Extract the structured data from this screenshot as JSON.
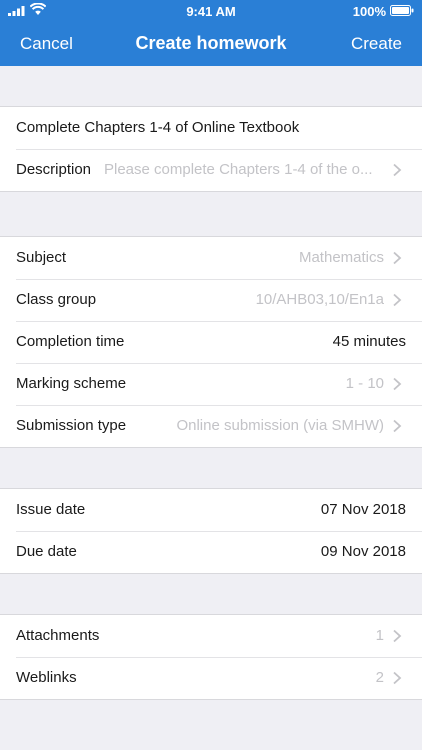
{
  "status": {
    "time": "9:41 AM",
    "battery": "100%"
  },
  "nav": {
    "cancel": "Cancel",
    "title": "Create homework",
    "create": "Create"
  },
  "homework": {
    "title": "Complete Chapters 1-4 of Online Textbook",
    "description_label": "Description",
    "description_placeholder": "Please complete Chapters 1-4 of the o..."
  },
  "details": {
    "subject_label": "Subject",
    "subject_value": "Mathematics",
    "class_group_label": "Class group",
    "class_group_value": "10/AHB03,10/En1a",
    "completion_time_label": "Completion time",
    "completion_time_value": "45 minutes",
    "marking_scheme_label": "Marking scheme",
    "marking_scheme_value": "1 - 10",
    "submission_type_label": "Submission type",
    "submission_type_value": "Online submission (via SMHW)"
  },
  "dates": {
    "issue_label": "Issue date",
    "issue_value": "07 Nov 2018",
    "due_label": "Due date",
    "due_value": "09 Nov 2018"
  },
  "resources": {
    "attachments_label": "Attachments",
    "attachments_value": "1",
    "weblinks_label": "Weblinks",
    "weblinks_value": "2"
  },
  "colors": {
    "header_blue": "#2a7fd6",
    "background": "#efeff4",
    "placeholder_gray": "#c3c3c7"
  }
}
